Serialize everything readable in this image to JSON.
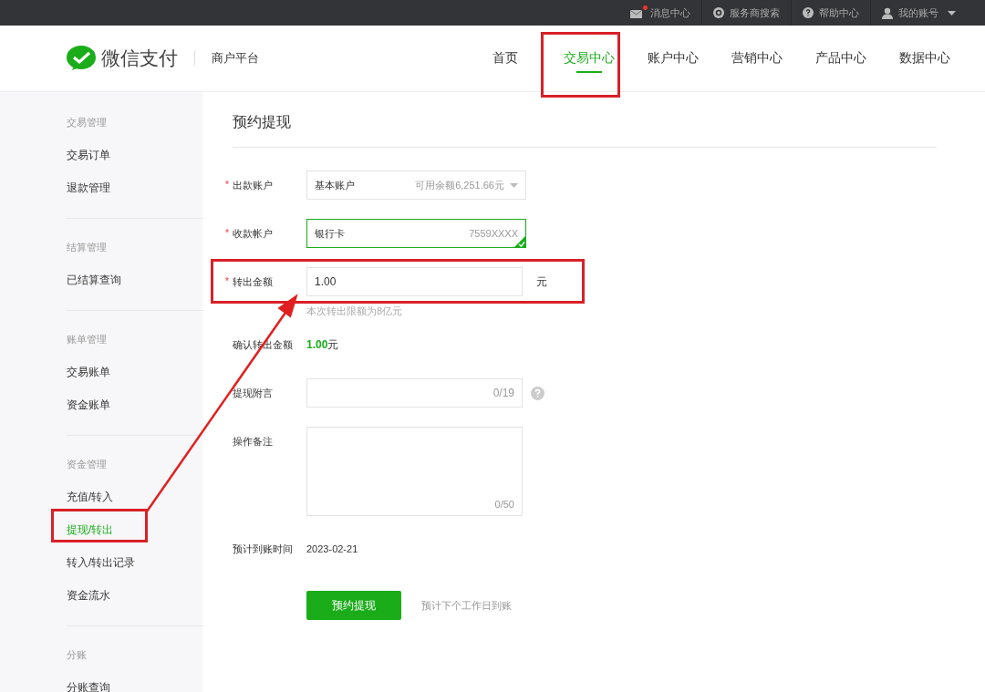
{
  "top_bar": {
    "items": [
      {
        "kind": "mail",
        "label": "消息中心",
        "unread": true
      },
      {
        "kind": "search",
        "label": "服务商搜索",
        "unread": false
      },
      {
        "kind": "help",
        "label": "帮助中心",
        "unread": false
      },
      {
        "kind": "account",
        "label": "我的账号",
        "unread": false
      }
    ]
  },
  "header": {
    "logo": "微信支付",
    "subtitle": "商户平台",
    "nav": [
      {
        "label": "首页",
        "selected": false
      },
      {
        "label": "交易中心",
        "selected": true
      },
      {
        "label": "账户中心",
        "selected": false
      },
      {
        "label": "营销中心",
        "selected": false
      },
      {
        "label": "产品中心",
        "selected": false
      },
      {
        "label": "数据中心",
        "selected": false
      }
    ]
  },
  "sidebar": {
    "groups": [
      {
        "title": "交易管理",
        "items": [
          {
            "label": "交易订单",
            "selected": false
          },
          {
            "label": "退款管理",
            "selected": false
          }
        ]
      },
      {
        "title": "结算管理",
        "items": [
          {
            "label": "已结算查询",
            "selected": false
          }
        ]
      },
      {
        "title": "账单管理",
        "items": [
          {
            "label": "交易账单",
            "selected": false
          },
          {
            "label": "资金账单",
            "selected": false
          }
        ]
      },
      {
        "title": "资金管理",
        "items": [
          {
            "label": "充值/转入",
            "selected": false
          },
          {
            "label": "提现/转出",
            "selected": true
          },
          {
            "label": "转入/转出记录",
            "selected": false
          },
          {
            "label": "资金流水",
            "selected": false
          }
        ]
      },
      {
        "title": "分账",
        "items": [
          {
            "label": "分账查询",
            "selected": false
          }
        ]
      }
    ]
  },
  "page_title": "预约提现",
  "form": [
    {
      "kind": "select",
      "label": "出款账户",
      "marker": "*",
      "value": "基本账户",
      "note": "可用余额6,251.66元"
    },
    {
      "kind": "account",
      "label": "收款帐户",
      "marker": "*",
      "value": "银行卡",
      "note": "7559XXXX",
      "verified": true
    },
    {
      "kind": "amount",
      "label": "转出金额",
      "marker": "*",
      "value": "1.00",
      "unit": "元",
      "hint": "本次转出限额为8亿元"
    },
    {
      "kind": "confirm",
      "label": "确认转出金额",
      "amount": "1.00",
      "unit": "元"
    },
    {
      "kind": "text",
      "label": "提现附言",
      "counter": "0/19"
    },
    {
      "kind": "textarea",
      "label": "操作备注",
      "counter": "0/50"
    },
    {
      "kind": "static",
      "label": "预计到账时间",
      "value": "2023-02-21"
    }
  ],
  "submit": {
    "label": "预约提现",
    "note": "预计下个工作日到账"
  }
}
